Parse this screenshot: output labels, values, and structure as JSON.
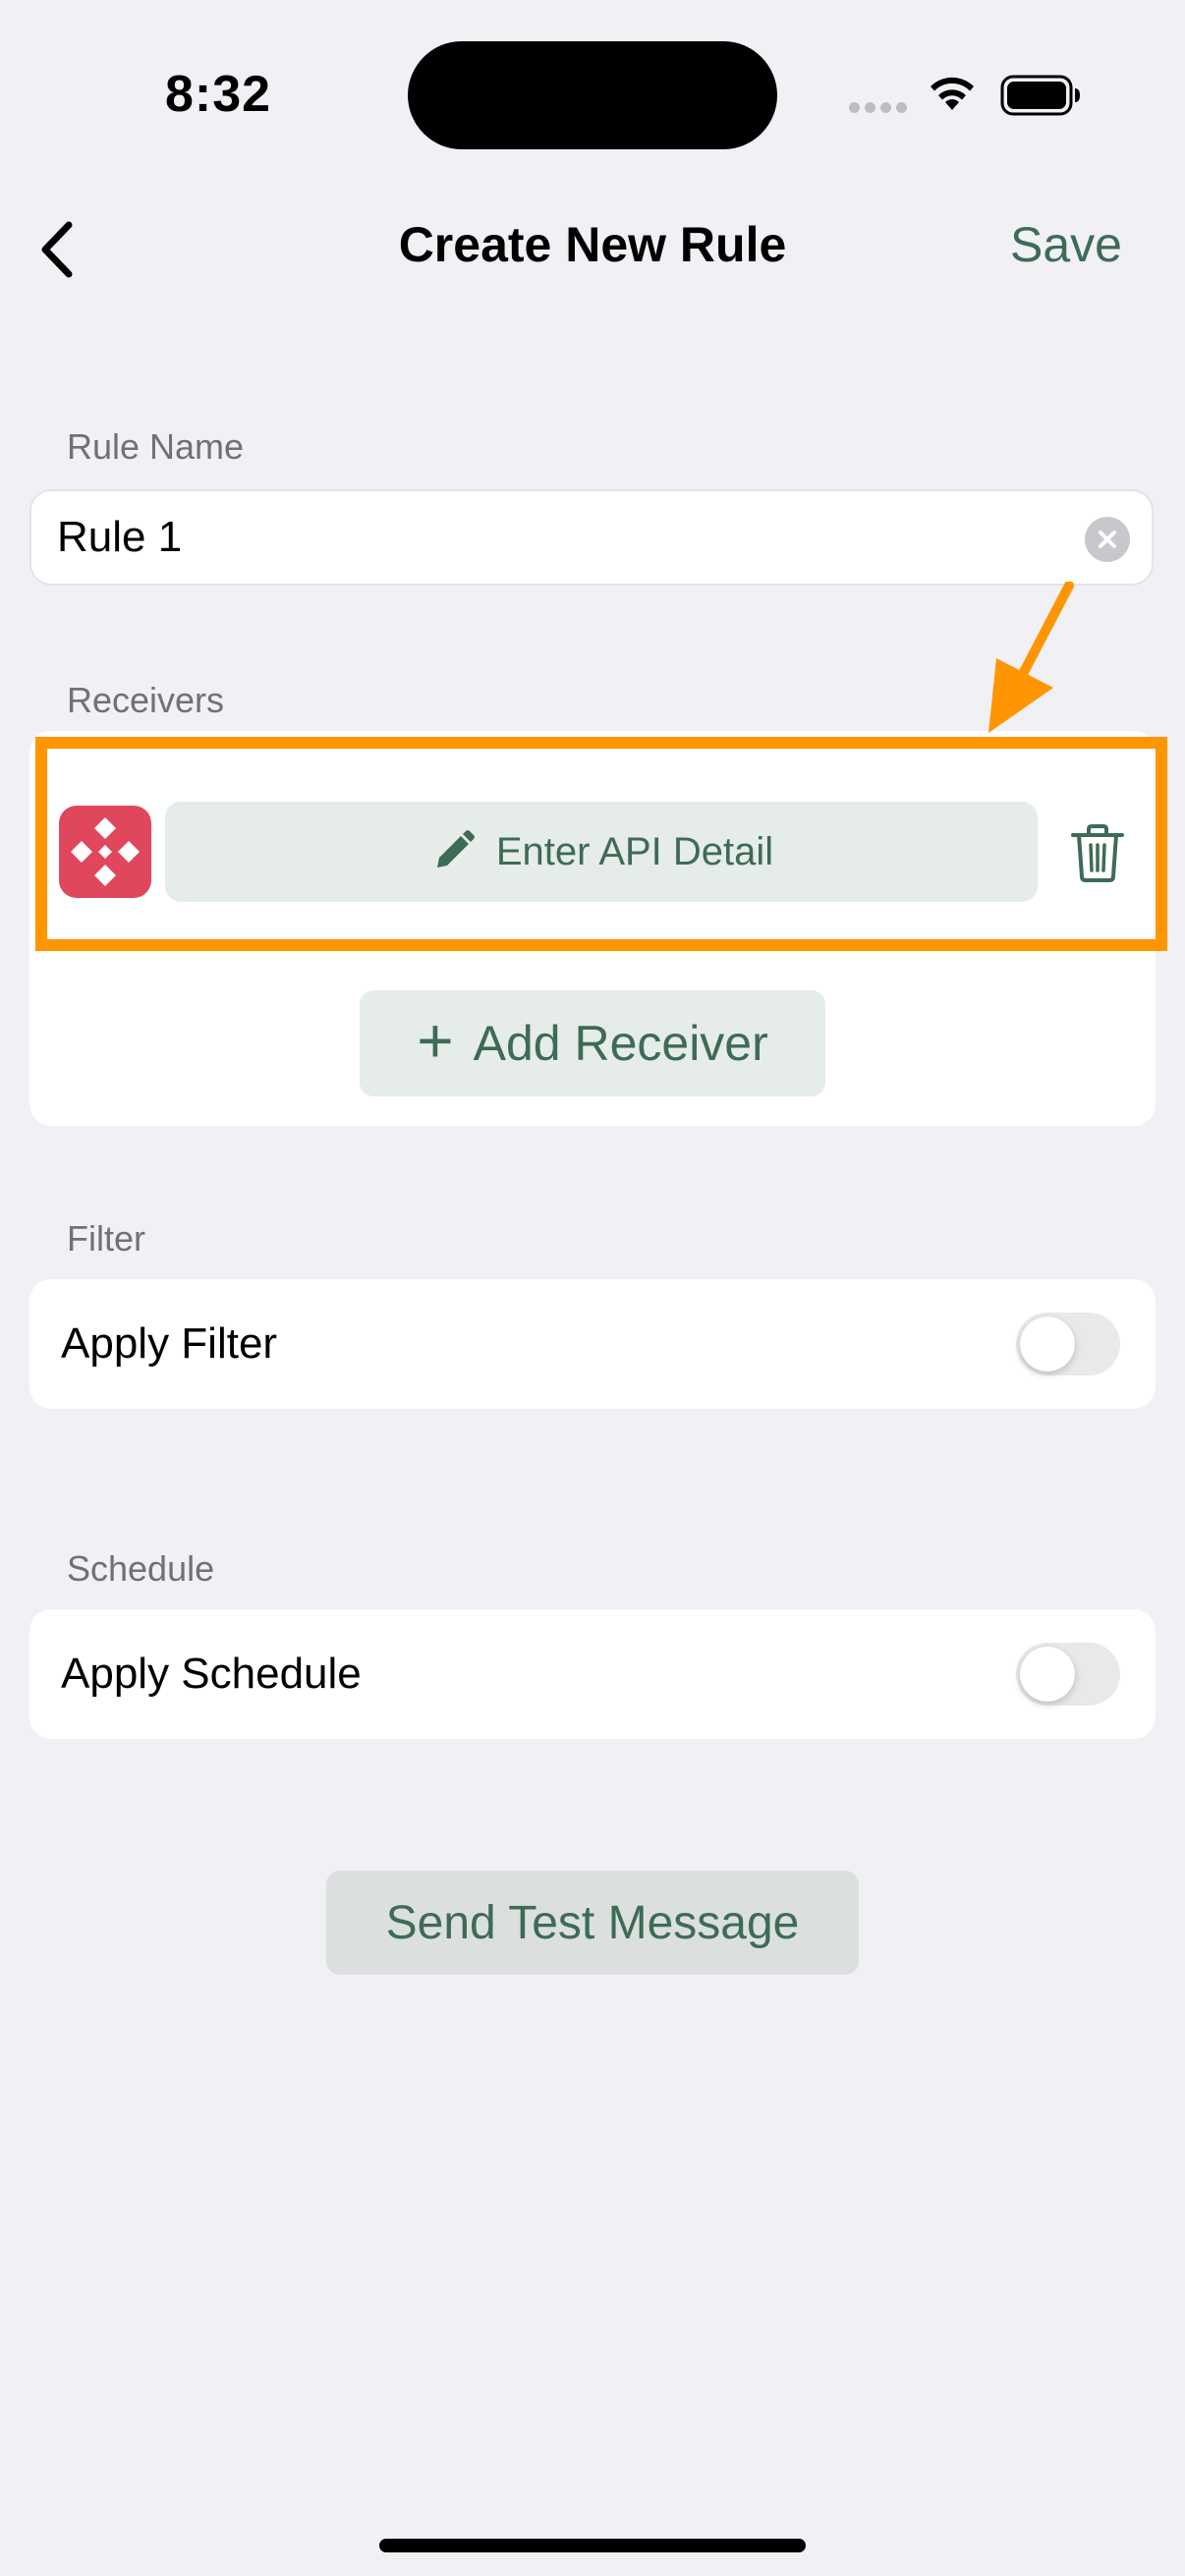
{
  "status_bar": {
    "time": "8:32"
  },
  "nav": {
    "title": "Create New Rule",
    "save_label": "Save"
  },
  "rule_name": {
    "label": "Rule Name",
    "value": "Rule 1"
  },
  "receivers": {
    "label": "Receivers",
    "items": [
      {
        "api_button_label": "Enter API Detail"
      }
    ],
    "add_label": "Add Receiver"
  },
  "filter": {
    "label": "Filter",
    "toggle_label": "Apply Filter",
    "enabled": false
  },
  "schedule": {
    "label": "Schedule",
    "toggle_label": "Apply Schedule",
    "enabled": false
  },
  "send_test_label": "Send Test Message",
  "colors": {
    "accent": "#3e6b56",
    "highlight": "#ff9500",
    "receiver_logo": "#e0475c",
    "background": "#f0f0f5"
  },
  "icons": {
    "back": "chevron-left-icon",
    "clear": "clear-circle-icon",
    "edit": "pencil-icon",
    "delete": "trash-icon",
    "add": "plus-icon",
    "annotation": "orange-arrow-icon"
  }
}
